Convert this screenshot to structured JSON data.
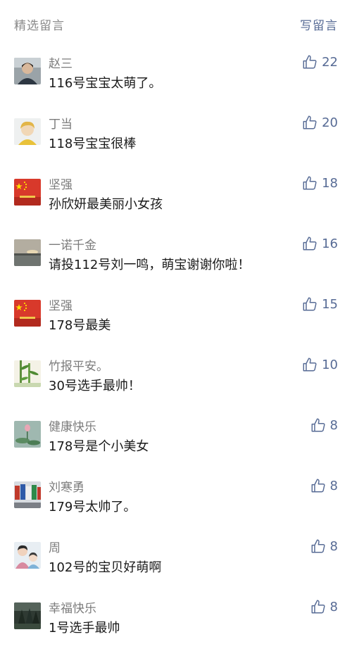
{
  "header": {
    "title": "精选留言",
    "write_label": "写留言"
  },
  "comments": [
    {
      "nickname": "赵三",
      "content": "116号宝宝太萌了。",
      "likes": "22",
      "avatar": "person-dark-icon"
    },
    {
      "nickname": "丁当",
      "content": "118号宝宝很棒",
      "likes": "20",
      "avatar": "blonde-person-icon"
    },
    {
      "nickname": "坚强",
      "content": "孙欣妍最美丽小女孩",
      "likes": "18",
      "avatar": "red-flag-gate-icon"
    },
    {
      "nickname": "一诺千金",
      "content": "请投112号刘一鸣，萌宝谢谢你啦！",
      "likes": "16",
      "avatar": "lake-sunset-icon"
    },
    {
      "nickname": "坚强",
      "content": "178号最美",
      "likes": "15",
      "avatar": "red-flag-gate-icon"
    },
    {
      "nickname": "竹报平安。",
      "content": "30号选手最帅！",
      "likes": "10",
      "avatar": "bamboo-icon"
    },
    {
      "nickname": "健康快乐",
      "content": "178号是个小美女",
      "likes": "8",
      "avatar": "lotus-icon"
    },
    {
      "nickname": "刘寒勇",
      "content": "179号太帅了。",
      "likes": "8",
      "avatar": "flags-icon"
    },
    {
      "nickname": "周",
      "content": "102号的宝贝好萌啊",
      "likes": "8",
      "avatar": "mother-child-icon"
    },
    {
      "nickname": "幸福快乐",
      "content": "1号选手最帅",
      "likes": "8",
      "avatar": "forest-dark-icon"
    }
  ],
  "colors": {
    "link": "#576b95",
    "nickname": "#7c7c7c",
    "content": "#1a1a1a",
    "header_title": "#8a8a8a"
  }
}
